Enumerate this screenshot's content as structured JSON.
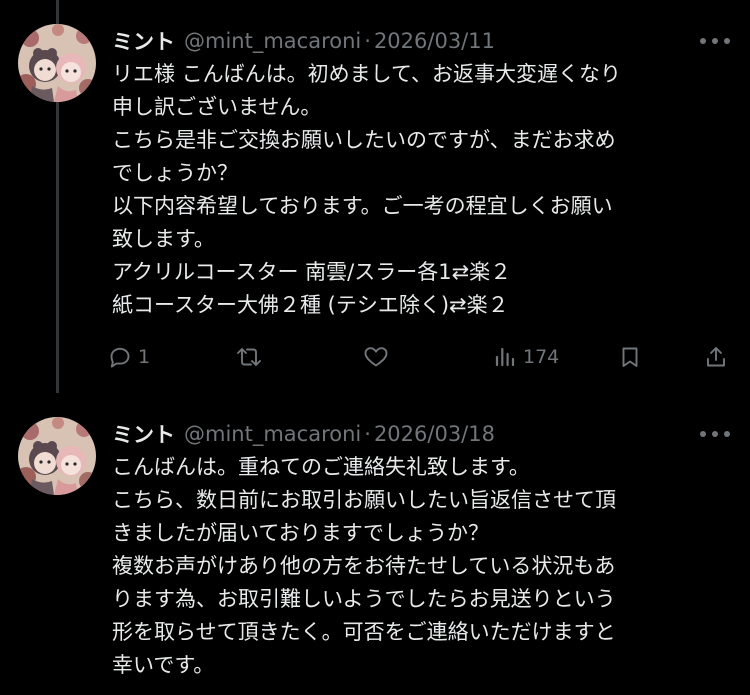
{
  "colors": {
    "background": "#000000",
    "text": "#e7e9ea",
    "muted": "#71767b",
    "thread_line": "#333639"
  },
  "posts": [
    {
      "display_name": "ミント",
      "handle": "@mint_macaroni",
      "separator": "·",
      "date": "2026/03/11",
      "avatar_icon": "avatar-image",
      "lines": [
        "リエ様 こんばんは。初めまして、お返事大変遅くなり",
        "申し訳ございません。",
        "こちら是非ご交換お願いしたいのですが、まだお求め",
        "でしょうか？",
        "以下内容希望しております。ご一考の程宜しくお願い",
        "致します。",
        "アクリルコースター 南雲/スラー各1⇄楽２",
        "紙コースター大佛２種 (テシエ除く)⇄楽２"
      ],
      "actions": {
        "reply_count": "1",
        "retweet_count": "",
        "like_count": "",
        "view_count": "174"
      }
    },
    {
      "display_name": "ミント",
      "handle": "@mint_macaroni",
      "separator": "·",
      "date": "2026/03/18",
      "avatar_icon": "avatar-image",
      "lines": [
        "こんばんは。重ねてのご連絡失礼致します。",
        "こちら、数日前にお取引お願いしたい旨返信させて頂",
        "きましたが届いておりますでしょうか？",
        "複数お声がけあり他の方をお待たせしている状況もあ",
        "ります為、お取引難しいようでしたらお見送りという",
        "形を取らせて頂きたく。可否をご連絡いただけますと",
        "幸いです。"
      ]
    }
  ]
}
